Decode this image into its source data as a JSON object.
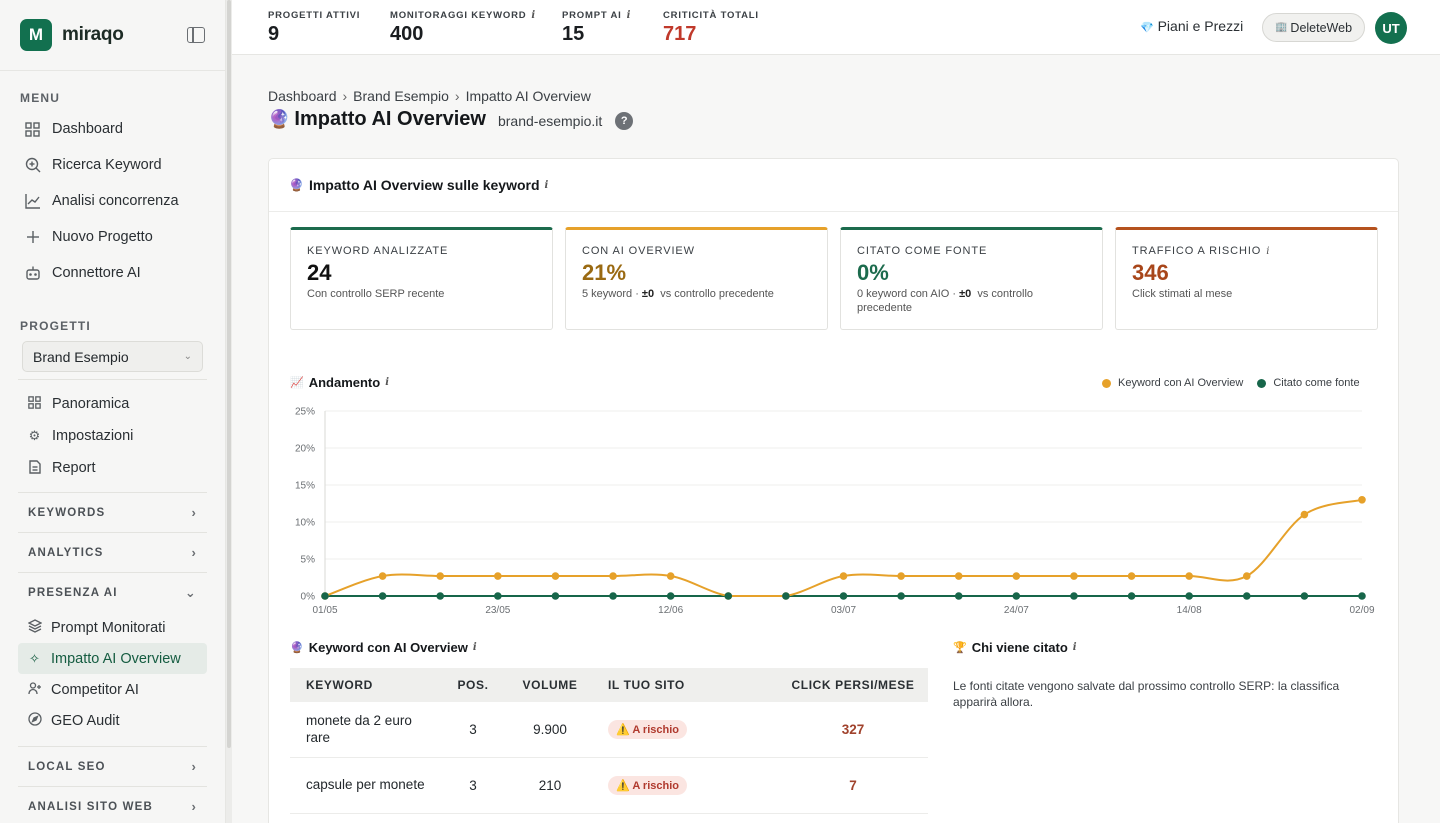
{
  "brand": {
    "logo_letter": "M",
    "name": "miraqo"
  },
  "sidebar": {
    "menu_label": "MENU",
    "menu_items": [
      {
        "label": "Dashboard",
        "icon": "grid-icon"
      },
      {
        "label": "Ricerca Keyword",
        "icon": "search-plus-icon"
      },
      {
        "label": "Analisi concorrenza",
        "icon": "trend-icon"
      },
      {
        "label": "Nuovo Progetto",
        "icon": "plus-icon"
      },
      {
        "label": "Connettore AI",
        "icon": "bot-icon"
      }
    ],
    "projects_label": "PROGETTI",
    "project_select": "Brand Esempio",
    "project_items": [
      {
        "label": "Panoramica",
        "icon": "grid-icon"
      },
      {
        "label": "Impostazioni",
        "icon": "gear-icon"
      },
      {
        "label": "Report",
        "icon": "document-icon"
      }
    ],
    "groups": {
      "keywords": "KEYWORDS",
      "analytics": "ANALYTICS",
      "presenza_ai": "PRESENZA AI",
      "local_seo": "LOCAL SEO",
      "analisi_sito": "ANALISI SITO WEB"
    },
    "ai_items": [
      {
        "label": "Prompt Monitorati",
        "icon": "layers-icon"
      },
      {
        "label": "Impatto AI Overview",
        "icon": "sparkle-icon"
      },
      {
        "label": "Competitor AI",
        "icon": "users-icon"
      },
      {
        "label": "GEO Audit",
        "icon": "compass-icon"
      }
    ]
  },
  "topbar": {
    "stats": [
      {
        "label": "PROGETTI ATTIVI",
        "value": "9"
      },
      {
        "label": "MONITORAGGI KEYWORD",
        "value": "400"
      },
      {
        "label": "PROMPT AI",
        "value": "15"
      },
      {
        "label": "CRITICITÀ TOTALI",
        "value": "717"
      }
    ],
    "info_glyph": "i",
    "plans_gem": "💎",
    "plans": "Piani e Prezzi",
    "account_icon": "🏢",
    "account": "DeleteWeb",
    "avatar": "UT"
  },
  "breadcrumb": [
    "Dashboard",
    "Brand Esempio",
    "Impatto AI Overview"
  ],
  "breadcrumb_sep": "›",
  "page": {
    "emoji": "🔮",
    "title": "Impatto AI Overview",
    "domain": "brand-esempio.it",
    "help": "?"
  },
  "card": {
    "emoji": "🔮",
    "title": "Impatto AI Overview sulle keyword",
    "kpis": [
      {
        "label": "KEYWORD ANALIZZATE",
        "value": "24",
        "sub": "Con controllo SERP recente",
        "accent": "#1c6b4d",
        "value_color": "#111111"
      },
      {
        "label": "CON AI OVERVIEW",
        "value": "21%",
        "sub_pre": "5 keyword · ",
        "sub_bold": "±0",
        "sub_post": "  vs controllo precedente",
        "accent": "#e6a12a",
        "value_color": "#9a6a12"
      },
      {
        "label": "CITATO COME FONTE",
        "value": "0%",
        "sub_pre": "0 keyword con AIO · ",
        "sub_bold": "±0",
        "sub_post": "  vs controllo precedente",
        "accent": "#1c6b4d",
        "value_color": "#1c6b4d"
      },
      {
        "label": "TRAFFICO A RISCHIO",
        "value": "346",
        "sub": "Click stimati al mese",
        "accent": "#b5521e",
        "value_color": "#a8461a"
      }
    ]
  },
  "trend": {
    "emoji": "📈",
    "title": "Andamento",
    "legend": [
      {
        "label": "Keyword con AI Overview",
        "color": "#e6a12a"
      },
      {
        "label": "Citato come fonte",
        "color": "#17664a"
      }
    ]
  },
  "chart_data": {
    "type": "line",
    "x": [
      "01/05",
      "08/05",
      "15/05",
      "23/05",
      "30/05",
      "06/06",
      "12/06",
      "19/06",
      "26/06",
      "03/07",
      "10/07",
      "17/07",
      "24/07",
      "31/07",
      "07/08",
      "14/08",
      "21/08",
      "28/08",
      "02/09"
    ],
    "x_tick_labels": [
      "01/05",
      "23/05",
      "12/06",
      "03/07",
      "24/07",
      "14/08",
      "02/09"
    ],
    "x_tick_index": [
      0,
      3,
      6,
      9,
      12,
      15,
      18
    ],
    "y_ticks": [
      "0%",
      "5%",
      "10%",
      "15%",
      "20%",
      "25%"
    ],
    "ylim": [
      0,
      25
    ],
    "grid": true,
    "legend_position": "top-right",
    "series": [
      {
        "name": "Keyword con AI Overview",
        "color": "#e6a12a",
        "values": [
          0,
          2.7,
          2.7,
          2.7,
          2.7,
          2.7,
          2.7,
          0,
          0,
          2.7,
          2.7,
          2.7,
          2.7,
          2.7,
          2.7,
          2.7,
          2.7,
          11,
          13
        ]
      },
      {
        "name": "Citato come fonte",
        "color": "#17664a",
        "values": [
          0,
          0,
          0,
          0,
          0,
          0,
          0,
          0,
          0,
          0,
          0,
          0,
          0,
          0,
          0,
          0,
          0,
          0,
          0
        ]
      }
    ]
  },
  "keywords_table": {
    "emoji": "🔮",
    "title": "Keyword con AI Overview",
    "headers": [
      "KEYWORD",
      "POS.",
      "VOLUME",
      "IL TUO SITO",
      "CLICK PERSI/MESE"
    ],
    "rows": [
      {
        "keyword": "monete da 2 euro rare",
        "pos": "3",
        "volume": "9.900",
        "status": "⚠️ A rischio",
        "lost": "327"
      },
      {
        "keyword": "capsule per monete",
        "pos": "3",
        "volume": "210",
        "status": "⚠️ A rischio",
        "lost": "7"
      }
    ]
  },
  "cited": {
    "emoji": "🏆",
    "title": "Chi viene citato",
    "note": "Le fonti citate vengono salvate dal prossimo controllo SERP: la classifica apparirà allora."
  }
}
